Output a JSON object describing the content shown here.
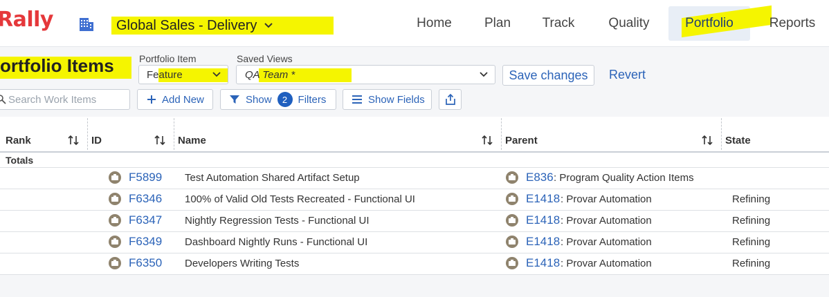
{
  "header": {
    "logo": "Rally",
    "workspace": "Global Sales - Delivery",
    "nav": [
      "Home",
      "Plan",
      "Track",
      "Quality",
      "Portfolio",
      "Reports"
    ],
    "active_nav": "Portfolio"
  },
  "page": {
    "title": "ortfolio Items",
    "portfolio_item_label": "Portfolio Item",
    "portfolio_item_value": "Feature",
    "saved_views_label": "Saved Views",
    "saved_views_value": "QA Team *",
    "save_changes": "Save changes",
    "revert": "Revert",
    "search_placeholder": "Search Work Items",
    "add_new": "Add New",
    "show_label": "Show",
    "filter_count": "2",
    "filters_label": "Filters",
    "show_fields": "Show Fields"
  },
  "table": {
    "columns": [
      "Rank",
      "ID",
      "Name",
      "Parent",
      "State"
    ],
    "totals_label": "Totals",
    "rows": [
      {
        "id": "F5899",
        "name": "Test Automation Shared Artifact Setup",
        "parent_id": "E836",
        "parent_name": ": Program Quality Action Items",
        "state": ""
      },
      {
        "id": "F6346",
        "name": "100% of Valid Old Tests Recreated - Functional UI",
        "parent_id": "E1418",
        "parent_name": ": Provar Automation",
        "state": "Refining"
      },
      {
        "id": "F6347",
        "name": "Nightly Regression Tests - Functional UI",
        "parent_id": "E1418",
        "parent_name": ": Provar Automation",
        "state": "Refining"
      },
      {
        "id": "F6349",
        "name": "Dashboard Nightly Runs - Functional UI",
        "parent_id": "E1418",
        "parent_name": ": Provar Automation",
        "state": "Refining"
      },
      {
        "id": "F6350",
        "name": "Developers Writing Tests",
        "parent_id": "E1418",
        "parent_name": ": Provar Automation",
        "state": "Refining"
      }
    ]
  },
  "colors": {
    "brand": "#e5383b",
    "link": "#2b63b8",
    "highlight": "#f5f500",
    "badge": "#1f5fbf"
  }
}
